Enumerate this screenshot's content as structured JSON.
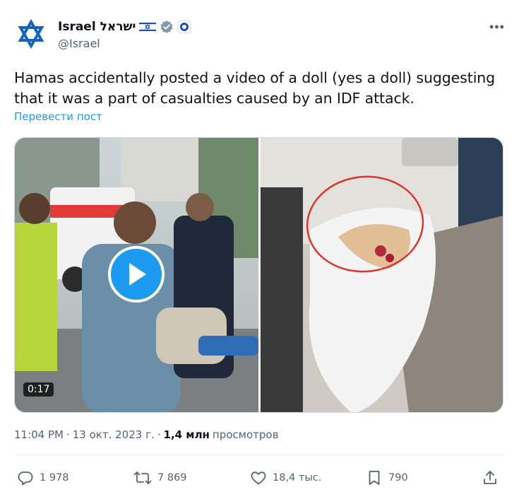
{
  "author": {
    "name": "Israel ישראל",
    "handle": "@Israel",
    "flag_icon": "israel-flag-icon",
    "verified_icon": "verified-badge-icon",
    "affiliation_icon": "government-seal-icon"
  },
  "tweet": {
    "text": "Hamas accidentally posted a video of a doll (yes a doll) suggesting that it was a part of casualties caused by an IDF attack.",
    "translate_label": "Перевести пост"
  },
  "media": {
    "video_duration": "0:17",
    "left_image": "video-still-street-scene",
    "right_image": "doll-wrapped-in-white-cloth-circled"
  },
  "meta": {
    "time": "11:04 PM",
    "separator": "·",
    "date": "13 окт. 2023 г.",
    "views_count": "1,4 млн",
    "views_label": "просмотров"
  },
  "actions": {
    "replies": "1 978",
    "reposts": "7 869",
    "likes": "18,4 тыс.",
    "bookmarks": "790"
  },
  "colors": {
    "accent": "#1d9bf0",
    "text": "#0f1419",
    "secondary": "#536471",
    "circle": "#e0322e"
  }
}
